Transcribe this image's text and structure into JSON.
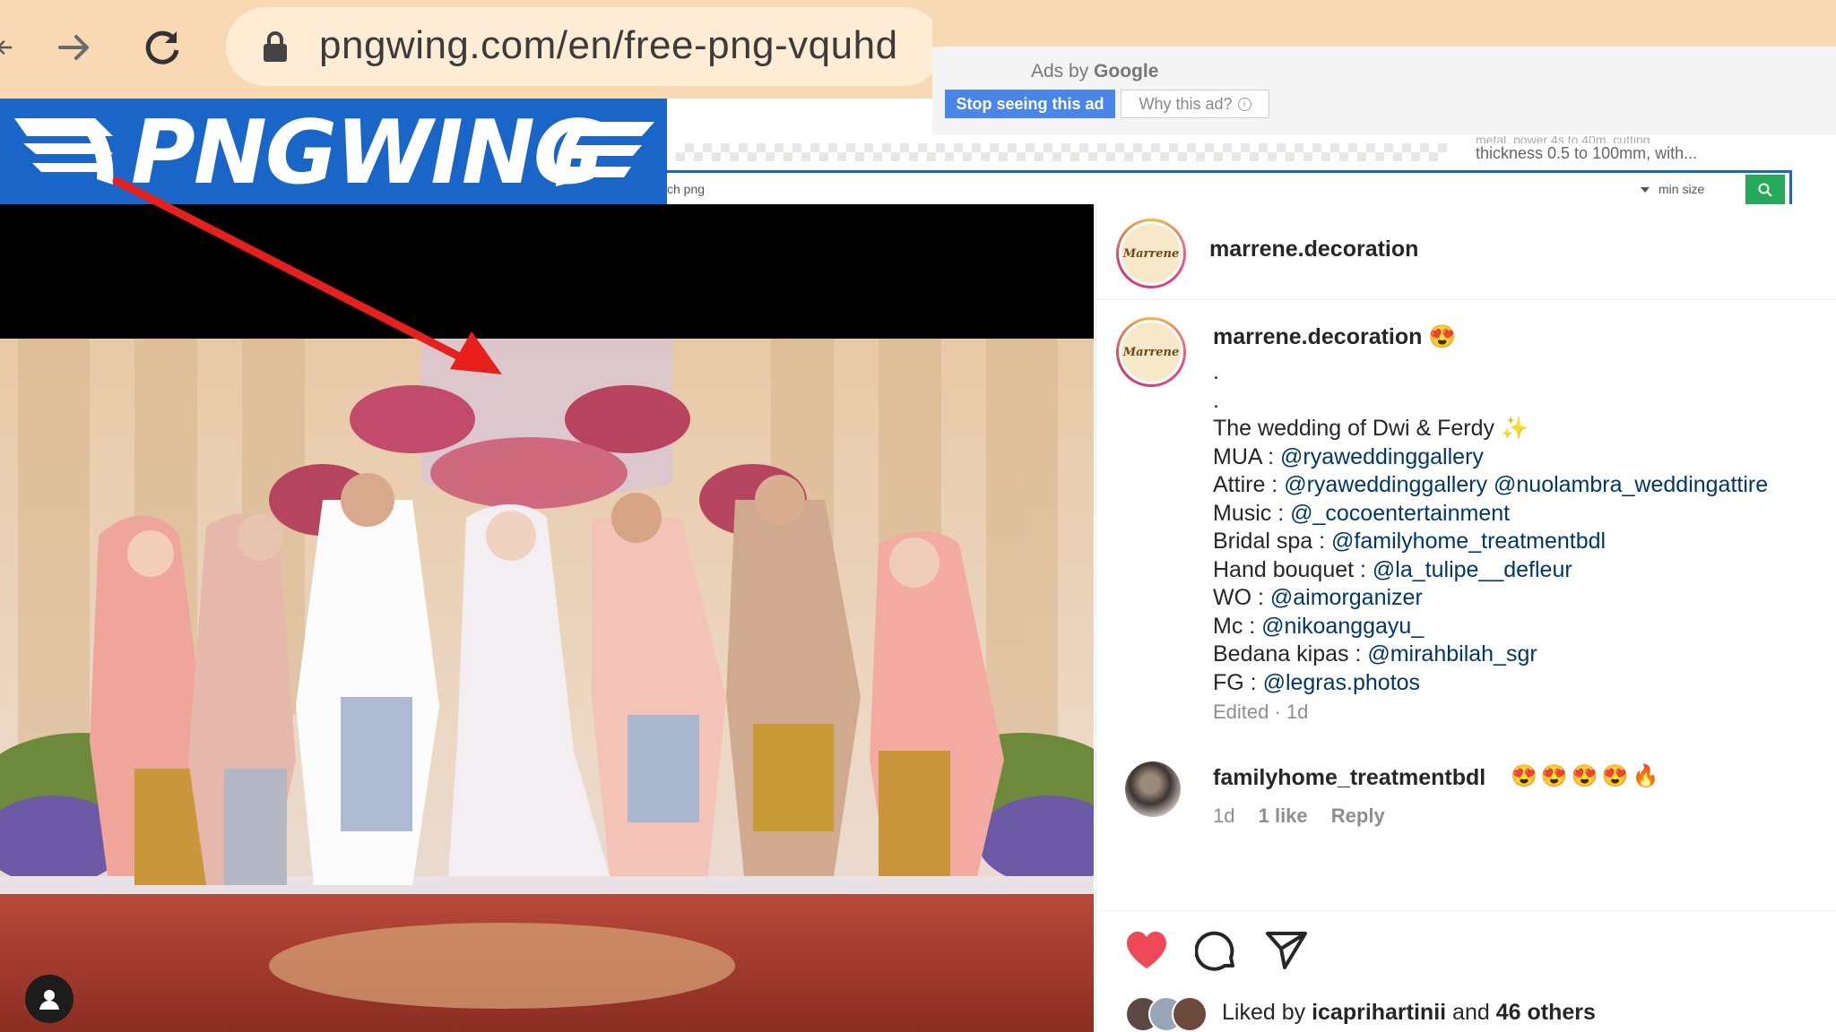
{
  "browser": {
    "url": "pngwing.com/en/free-png-vquhd",
    "icons": [
      "back-arrow-icon",
      "forward-arrow-icon",
      "reload-icon",
      "lock-icon"
    ]
  },
  "ad": {
    "ads_by": "Ads by",
    "ads_brand": "Google",
    "stop_label": "Stop seeing this ad",
    "why_label": "Why this ad?",
    "snippet_top": "metal, power 4s to 40m, cutting",
    "snippet": "thickness 0.5 to 100mm, with..."
  },
  "site": {
    "logo_text": "PNGWING",
    "search_placeholder": "ch png",
    "min_size_label": "min size",
    "brand_color": "#1a66c8",
    "search_button_color": "#25a95b"
  },
  "post": {
    "header_username": "marrene.decoration",
    "avatar_text": "Marrene",
    "caption_username": "marrene.decoration",
    "caption_username_emoji": "😍",
    "caption_lines": [
      {
        "label": ".",
        "mention": ""
      },
      {
        "label": ".",
        "mention": ""
      },
      {
        "label": "The wedding of Dwi & Ferdy ✨",
        "mention": ""
      },
      {
        "label": "MUA : ",
        "mention": "@ryaweddinggallery"
      },
      {
        "label": "Attire : ",
        "mention": "@ryaweddinggallery @nuolambra_weddingattire"
      },
      {
        "label": "Music : ",
        "mention": "@_cocoentertainment"
      },
      {
        "label": "Bridal spa : ",
        "mention": "@familyhome_treatmentbdl"
      },
      {
        "label": "Hand bouquet : ",
        "mention": "@la_tulipe__defleur"
      },
      {
        "label": "WO : ",
        "mention": "@aimorganizer"
      },
      {
        "label": "Mc : ",
        "mention": "@nikoanggayu_"
      },
      {
        "label": "Bedana kipas : ",
        "mention": "@mirahbilah_sgr"
      },
      {
        "label": "FG : ",
        "mention": "@legras.photos"
      }
    ],
    "edited": "Edited · 1d",
    "comment": {
      "username": "familyhome_treatmentbdl",
      "emojis": "😍😍😍😍🔥",
      "time": "1d",
      "likes": "1 like",
      "reply": "Reply"
    },
    "liked_prefix": "Liked by ",
    "liked_user": "icaprihartinii",
    "liked_mid": " and ",
    "liked_others": "46 others",
    "like_color": "#ed4956",
    "mention_color": "#00376b"
  }
}
